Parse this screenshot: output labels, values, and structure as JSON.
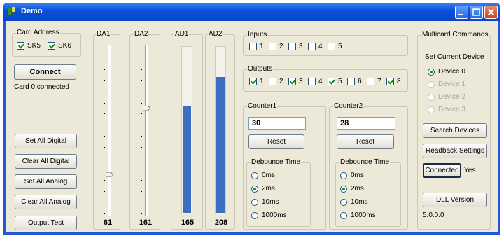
{
  "window": {
    "title": "Demo"
  },
  "card_address": {
    "legend": "Card Address",
    "checkboxes": [
      {
        "label": "SK5",
        "checked": true
      },
      {
        "label": "SK6",
        "checked": true
      }
    ]
  },
  "left_buttons": {
    "connect": "Connect",
    "status": "Card 0 connected",
    "set_all_digital": "Set All Digital",
    "clear_all_digital": "Clear All Digital",
    "set_all_analog": "Set All Analog",
    "clear_all_analog": "Clear All Analog",
    "output_test": "Output Test"
  },
  "channels": [
    {
      "label": "DA1",
      "kind": "slider",
      "value": "61",
      "level": 0.24
    },
    {
      "label": "DA2",
      "kind": "slider",
      "value": "161",
      "level": 0.63
    },
    {
      "label": "AD1",
      "kind": "bar",
      "value": "165",
      "level": 0.65
    },
    {
      "label": "AD2",
      "kind": "bar",
      "value": "208",
      "level": 0.82
    }
  ],
  "inputs": {
    "legend": "Inputs",
    "items": [
      {
        "label": "1",
        "checked": false
      },
      {
        "label": "2",
        "checked": false
      },
      {
        "label": "3",
        "checked": false
      },
      {
        "label": "4",
        "checked": false
      },
      {
        "label": "5",
        "checked": false
      }
    ]
  },
  "outputs": {
    "legend": "Outputs",
    "items": [
      {
        "label": "1",
        "checked": true
      },
      {
        "label": "2",
        "checked": false
      },
      {
        "label": "3",
        "checked": true
      },
      {
        "label": "4",
        "checked": false
      },
      {
        "label": "5",
        "checked": true
      },
      {
        "label": "6",
        "checked": false
      },
      {
        "label": "7",
        "checked": false
      },
      {
        "label": "8",
        "checked": true
      }
    ]
  },
  "counter1": {
    "legend": "Counter1",
    "value": "30",
    "reset": "Reset",
    "debounce_legend": "Debounce Time",
    "options": [
      "0ms",
      "2ms",
      "10ms",
      "1000ms"
    ],
    "selected": 1
  },
  "counter2": {
    "legend": "Counter2",
    "value": "28",
    "reset": "Reset",
    "debounce_legend": "Debounce Time",
    "options": [
      "0ms",
      "2ms",
      "10ms",
      "1000ms"
    ],
    "selected": 1
  },
  "multicard": {
    "legend": "Multicard Commands",
    "set_current": "Set Current Device",
    "devices": [
      {
        "label": "Device 0",
        "selected": true,
        "enabled": true
      },
      {
        "label": "Device 1",
        "selected": false,
        "enabled": false
      },
      {
        "label": "Device 2",
        "selected": false,
        "enabled": false
      },
      {
        "label": "Device 3",
        "selected": false,
        "enabled": false
      }
    ],
    "search_devices": "Search Devices",
    "readback_settings": "Readback Settings",
    "connected": "Connected",
    "connected_state": "Yes",
    "dll_version": "DLL Version",
    "version": "5.0.0.0"
  },
  "colors": {
    "title_bar": "#0a4fd6",
    "client_bg": "#ece9d8",
    "bar_fill": "#3a6fc1",
    "check_green": "#1a8a1a"
  }
}
